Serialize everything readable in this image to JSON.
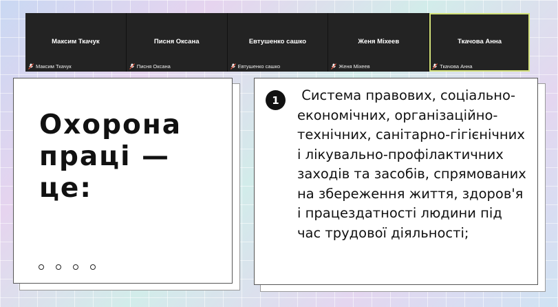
{
  "participants": [
    {
      "name": "Максим Ткачук",
      "label": "Максим Ткачук",
      "active": false
    },
    {
      "name": "Писня Оксана",
      "label": "Писня Оксана",
      "active": false
    },
    {
      "name": "Евтушенко сашко",
      "label": "Евтушенко сашко",
      "active": false
    },
    {
      "name": "Женя Міхеев",
      "label": "Женя Міхеев",
      "active": false
    },
    {
      "name": "Ткачова Анна",
      "label": "Ткачова Анна",
      "active": true
    }
  ],
  "slide_left": {
    "title": "Охорона праці — це:",
    "dots": 4
  },
  "slide_right": {
    "number": "1",
    "text": " Система правових, соціально-економічних, організаційно-технічних, санітарно-гігієнічних і лікувально-профілактичних заходів та засобів, спрямованих на збереження життя, здоров'я і працездатності людини під час трудової діяльності;"
  },
  "icons": {
    "muted_mic": "muted-microphone-icon"
  },
  "colors": {
    "active_speaker_border": "#d4e27a",
    "mic_muted": "#e0533d"
  }
}
